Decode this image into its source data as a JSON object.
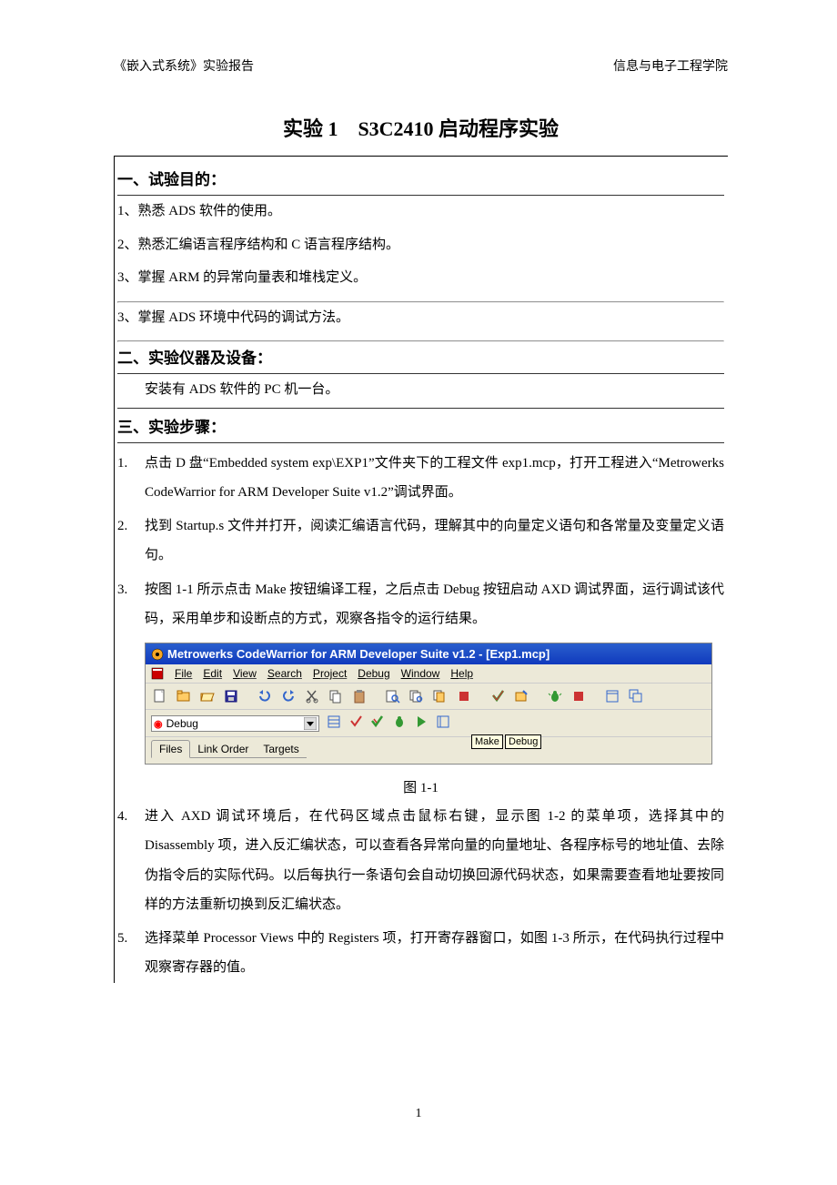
{
  "header": {
    "left": "《嵌入式系统》实验报告",
    "right": "信息与电子工程学院"
  },
  "title": "实验 1　S3C2410 启动程序实验",
  "s1": {
    "heading": "一、试验目的：",
    "items": [
      "1、熟悉 ADS 软件的使用。",
      "2、熟悉汇编语言程序结构和 C 语言程序结构。",
      "3、掌握 ARM 的异常向量表和堆栈定义。",
      "3、掌握 ADS 环境中代码的调试方法。"
    ]
  },
  "s2": {
    "heading": "二、实验仪器及设备：",
    "body": "安装有 ADS 软件的 PC 机一台。"
  },
  "s3": {
    "heading": "三、实验步骤：",
    "items": [
      {
        "n": "1.",
        "t": "点击 D 盘“Embedded system exp\\EXP1”文件夹下的工程文件 exp1.mcp，打开工程进入“Metrowerks CodeWarrior for ARM Developer Suite v1.2”调试界面。"
      },
      {
        "n": "2.",
        "t": "找到 Startup.s 文件并打开，阅读汇编语言代码，理解其中的向量定义语句和各常量及变量定义语句。"
      },
      {
        "n": "3.",
        "t": "按图 1-1 所示点击 Make 按钮编译工程，之后点击 Debug 按钮启动 AXD 调试界面，运行调试该代码，采用单步和设断点的方式，观察各指令的运行结果。"
      },
      {
        "n": "4.",
        "t": "进入 AXD 调试环境后，在代码区域点击鼠标右键，显示图 1-2 的菜单项，选择其中的 Disassembly 项，进入反汇编状态，可以查看各异常向量的向量地址、各程序标号的地址值、去除伪指令后的实际代码。以后每执行一条语句会自动切换回源代码状态，如果需要查看地址要按同样的方法重新切换到反汇编状态。"
      },
      {
        "n": "5.",
        "t": "选择菜单 Processor Views 中的 Registers 项，打开寄存器窗口，如图 1-3 所示，在代码执行过程中观察寄存器的值。"
      }
    ]
  },
  "figure": {
    "caption": "图 1-1",
    "ide": {
      "title": "Metrowerks CodeWarrior for ARM Developer Suite v1.2 - [Exp1.mcp]",
      "menu": [
        "File",
        "Edit",
        "View",
        "Search",
        "Project",
        "Debug",
        "Window",
        "Help"
      ],
      "dropdown": "Debug",
      "tabs": [
        "Files",
        "Link Order",
        "Targets"
      ],
      "tooltips": {
        "make": "Make",
        "debug": "Debug"
      }
    }
  },
  "pagenum": "1"
}
